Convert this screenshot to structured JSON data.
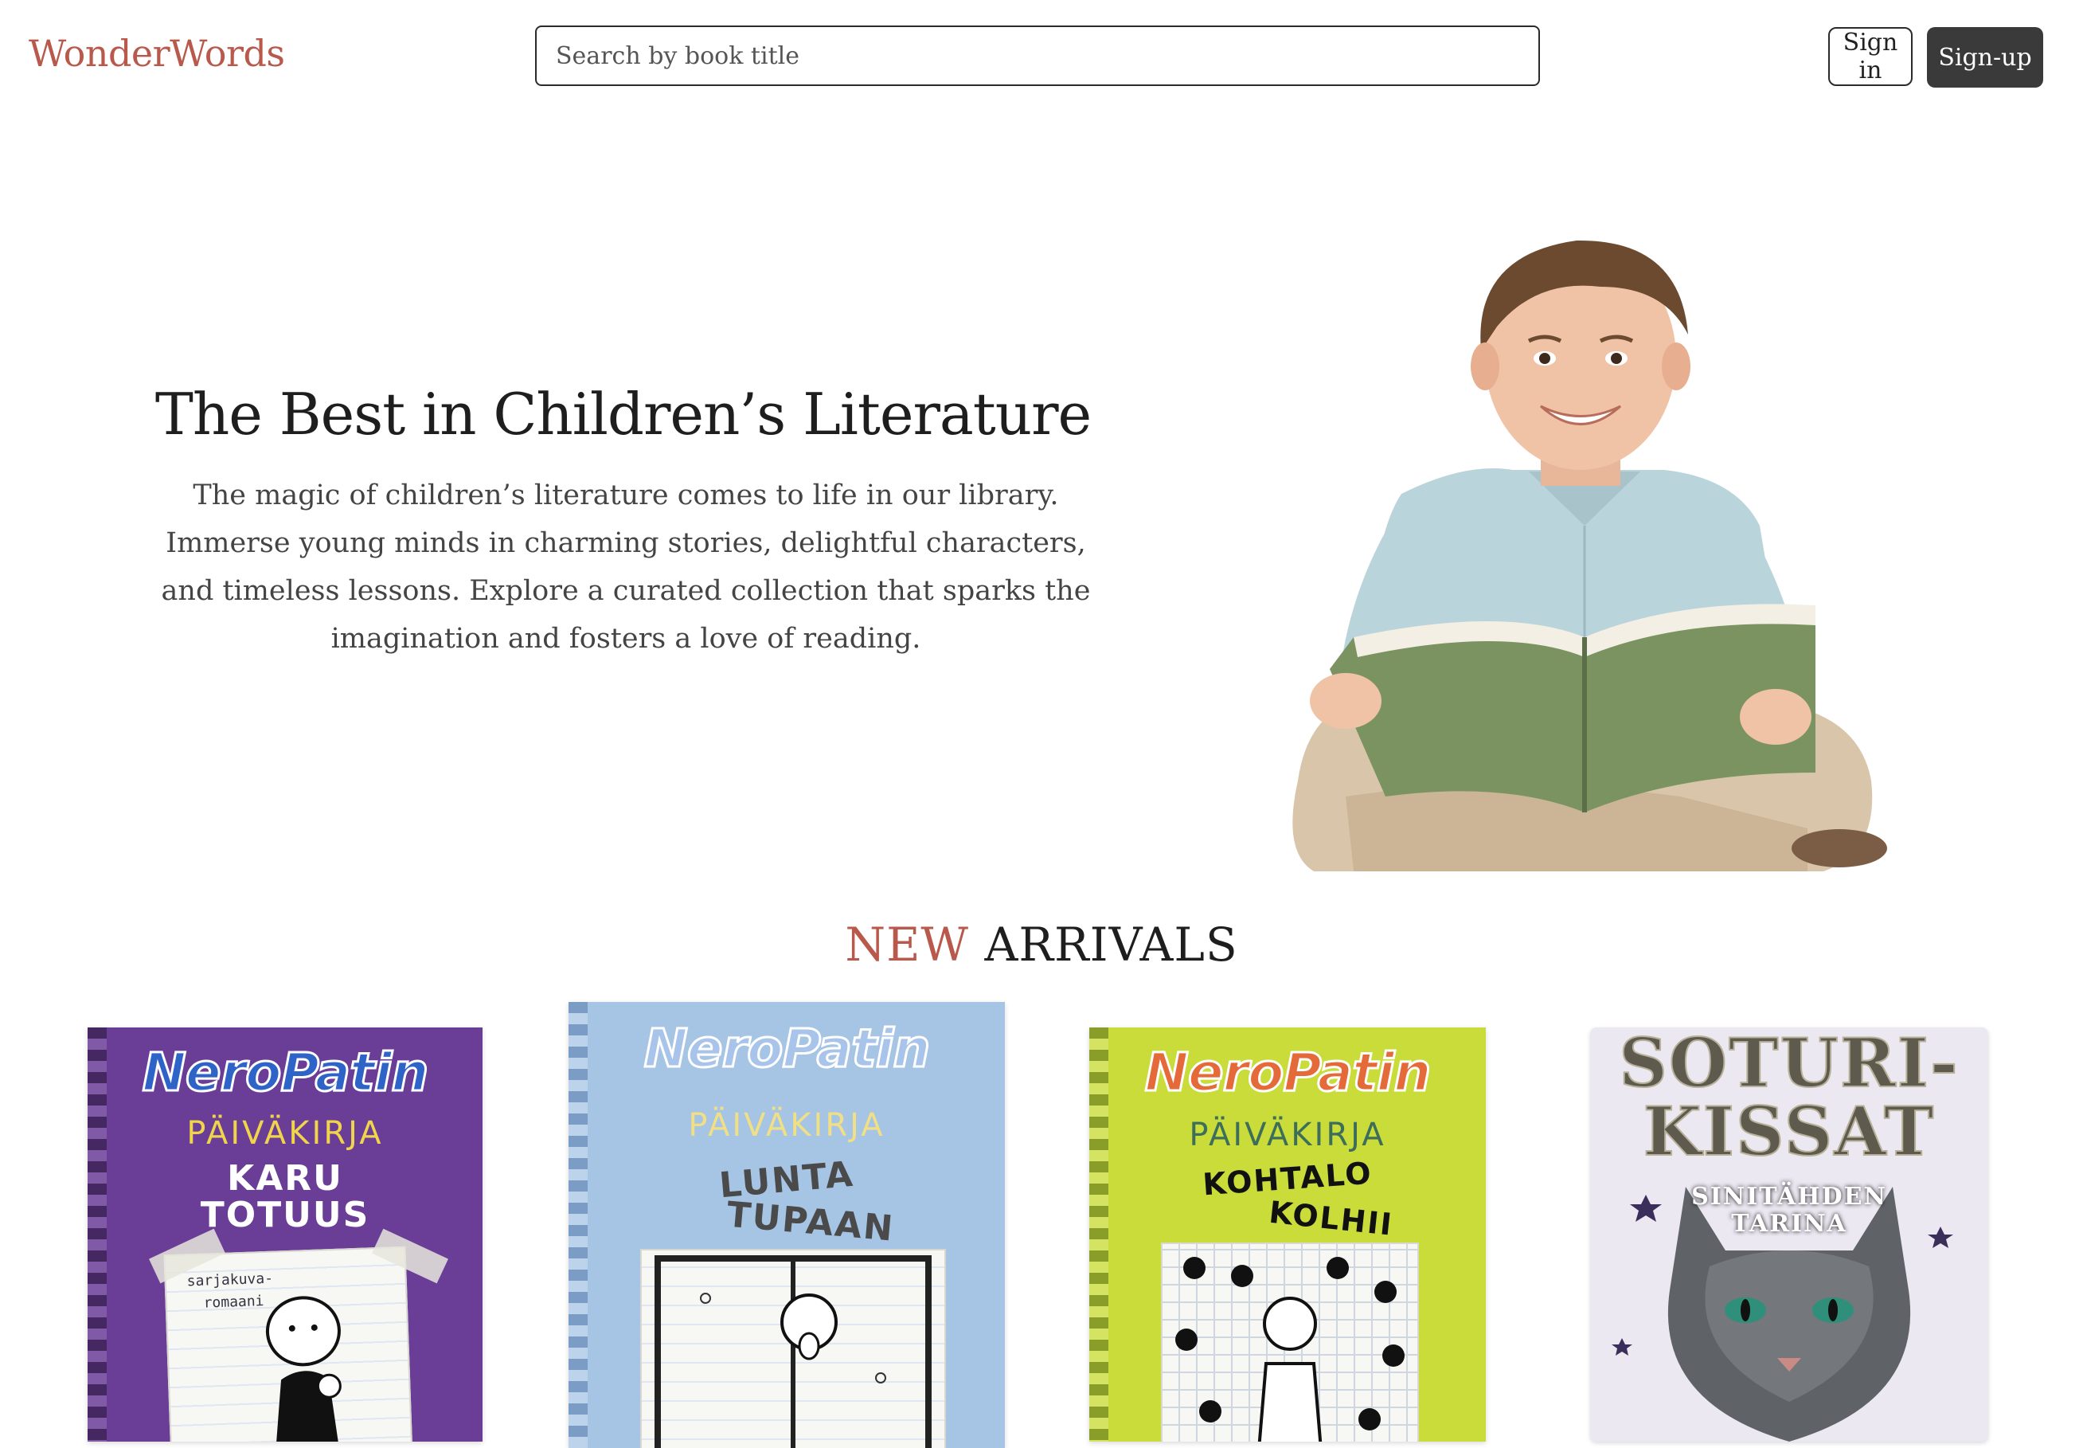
{
  "brand": {
    "name": "WonderWords",
    "color": "#b8594c"
  },
  "search": {
    "placeholder": "Search by book title",
    "icon": "search-field"
  },
  "auth": {
    "signin_label": "Sign in",
    "signup_label": "Sign-up"
  },
  "hero": {
    "title": "The Best in Children’s Literature",
    "description": "The magic of children’s literature comes to life in our library. Immerse young minds in charming stories, delightful characters, and timeless lessons. Explore a curated collection that sparks the imagination and fosters a love of reading.",
    "image": "boy-reading-book-photo"
  },
  "new_arrivals": {
    "title_accent": "NEW",
    "title_rest": "ARRIVALS",
    "books": [
      {
        "series": "NeroPatin",
        "subseries": "PÄIVÄKIRJA",
        "title_line1": "KARU",
        "title_line2": "TOTUUS",
        "note_line1": "sarjakuva-",
        "note_line2": "romaani",
        "cover_color": "#6a3d97"
      },
      {
        "series": "NeroPatin",
        "subseries": "PÄIVÄKIRJA",
        "title_line1": "LUNTA",
        "title_line2": "TUPAAN",
        "cover_color": "#a6c4e4"
      },
      {
        "series": "NeroPatin",
        "subseries": "PÄIVÄKIRJA",
        "title_line1": "KOHTALO",
        "title_line2": "KOLHII",
        "cover_color": "#c9dc3a"
      },
      {
        "series_line1": "SOTURI-",
        "series_line2": "KISSAT",
        "subtitle_line1": "SINITÄHDEN",
        "subtitle_line2": "TARINA",
        "cover_color": "#ece8f2"
      }
    ]
  }
}
